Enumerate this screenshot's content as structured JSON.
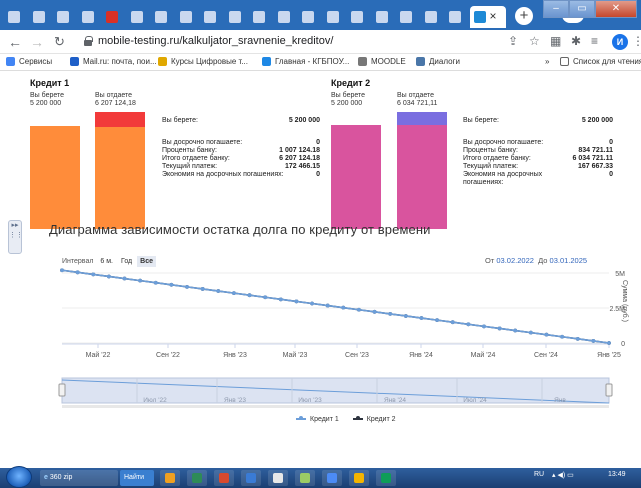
{
  "browser": {
    "tabs": [
      {
        "color": "#c9d8ef"
      },
      {
        "color": "#c9d8ef"
      },
      {
        "color": "#c9d8ef"
      },
      {
        "color": "#c9d8ef"
      },
      {
        "color": "#d93025"
      },
      {
        "color": "#c9d8ef"
      },
      {
        "color": "#c9d8ef"
      },
      {
        "color": "#c9d8ef"
      },
      {
        "color": "#c9d8ef"
      },
      {
        "color": "#c9d8ef"
      },
      {
        "color": "#c9d8ef"
      },
      {
        "color": "#c9d8ef"
      },
      {
        "color": "#c9d8ef"
      },
      {
        "color": "#c9d8ef"
      },
      {
        "color": "#c9d8ef"
      },
      {
        "color": "#c9d8ef"
      },
      {
        "color": "#c9d8ef"
      },
      {
        "color": "#c9d8ef"
      },
      {
        "color": "#c9d8ef"
      },
      {
        "color": "#c9d8ef"
      }
    ],
    "active_tab_close": "×",
    "new_tab": "+",
    "url": "mobile-testing.ru/kalkuljator_sravnenie_kreditov/",
    "profile_initial": "И",
    "bookmarks": [
      {
        "label": "Сервисы",
        "icon": "apps-icon",
        "color": "#4285f4"
      },
      {
        "label": "Mail.ru: почта, пои...",
        "icon": "mail-icon",
        "color": "#1e5fc8"
      },
      {
        "label": "Курсы Цифровые т...",
        "icon": "hat-icon",
        "color": "#e0a800"
      },
      {
        "label": "Главная - КГБПОУ...",
        "icon": "globe-icon",
        "color": "#1e88e5"
      },
      {
        "label": "MOODLE",
        "icon": "moodle-icon",
        "color": "#777777"
      },
      {
        "label": "Диалоги",
        "icon": "vk-icon",
        "color": "#4a76a8"
      }
    ],
    "bookmarks_more": "»",
    "reading_list": "Список для чтения"
  },
  "credit1": {
    "title": "Кредит 1",
    "take_label": "Вы берете",
    "take_value": "5 200 000",
    "give_label": "Вы отдаете",
    "give_value": "6 207 124,18",
    "colors": {
      "take": "#ff8c3a",
      "give": "#ff8c3a",
      "interest": "#f23a3a"
    },
    "summary": {
      "take_label": "Вы берете:",
      "take_value": "5 200 000",
      "early_label": "Вы досрочно погашаете:",
      "early_value": "0",
      "interest_label": "Проценты банку:",
      "interest_value": "1 007 124.18",
      "total_label": "Итого отдаете банку:",
      "total_value": "6 207 124.18",
      "payment_label": "Текущий платеж:",
      "payment_value": "172 466.15",
      "savings_label": "Экономия на досрочных погашениях:",
      "savings_value": "0"
    }
  },
  "credit2": {
    "title": "Кредит 2",
    "take_label": "Вы берете",
    "take_value": "5 200 000",
    "give_label": "Вы отдаете",
    "give_value": "6 034 721,11",
    "colors": {
      "take": "#d9549e",
      "give": "#d9549e",
      "interest": "#7a6ee0"
    },
    "summary": {
      "take_label": "Вы берете:",
      "take_value": "5 200 000",
      "early_label": "Вы досрочно погашаете:",
      "early_value": "0",
      "interest_label": "Проценты банку:",
      "interest_value": "834 721.11",
      "total_label": "Итого отдаете банку:",
      "total_value": "6 034 721.11",
      "payment_label": "Текущий платеж:",
      "payment_value": "167 667.33",
      "savings_label": "Экономия на досрочных погашениях:",
      "savings_value": "0"
    }
  },
  "chart": {
    "title": "Диаграмма зависимости остатка долга по кредиту от времени",
    "range_label": "Интервал",
    "range_buttons": [
      "6 м.",
      "Год",
      "Все"
    ],
    "range_selected": "Все",
    "from_label": "От",
    "from_value": "03.02.2022",
    "to_label": "До",
    "to_value": "03.01.2025",
    "y_axis_title": "Сумма (руб.)",
    "navigator_ticks": [
      "Июл '22",
      "Янв '23",
      "Июл '23",
      "Янв '24",
      "Июл '24",
      "Янв"
    ]
  },
  "chart_data": {
    "type": "line",
    "title": "Диаграмма зависимости остатка долга по кредиту от времени",
    "xlabel": "",
    "ylabel": "Сумма (руб.)",
    "x_ticks": [
      "Май '22",
      "Сен '22",
      "Янв '23",
      "Май '23",
      "Сен '23",
      "Янв '24",
      "Май '24",
      "Сен '24",
      "Янв '25"
    ],
    "y_ticks": [
      "0",
      "2.5M",
      "5M"
    ],
    "ylim": [
      0,
      6000000
    ],
    "xlim": [
      "2022-02-03",
      "2025-01-03"
    ],
    "series": [
      {
        "name": "Кредит 1",
        "color": "#6c9ed9",
        "start": "2022-02-03",
        "points": 36,
        "start_value": 5200000,
        "end_value": 0
      },
      {
        "name": "Кредит 2",
        "color": "#2f3540",
        "start": "2022-02-03",
        "points": 36,
        "start_value": 5200000,
        "end_value": 0
      }
    ],
    "legend_position": "bottom",
    "grid": true
  },
  "taskbar": {
    "search_hint": "360 zip",
    "find_label": "Найти",
    "lang": "RU",
    "clock": "13:49",
    "apps": [
      {
        "color": "#f0a020"
      },
      {
        "color": "#2e8b57"
      },
      {
        "color": "#d84a2e"
      },
      {
        "color": "#3a7bd5"
      },
      {
        "color": "#e8e8e8"
      },
      {
        "color": "#9ccc65"
      },
      {
        "color": "#4c8bf5"
      },
      {
        "color": "#f4b400"
      },
      {
        "color": "#0f9d58"
      }
    ]
  }
}
